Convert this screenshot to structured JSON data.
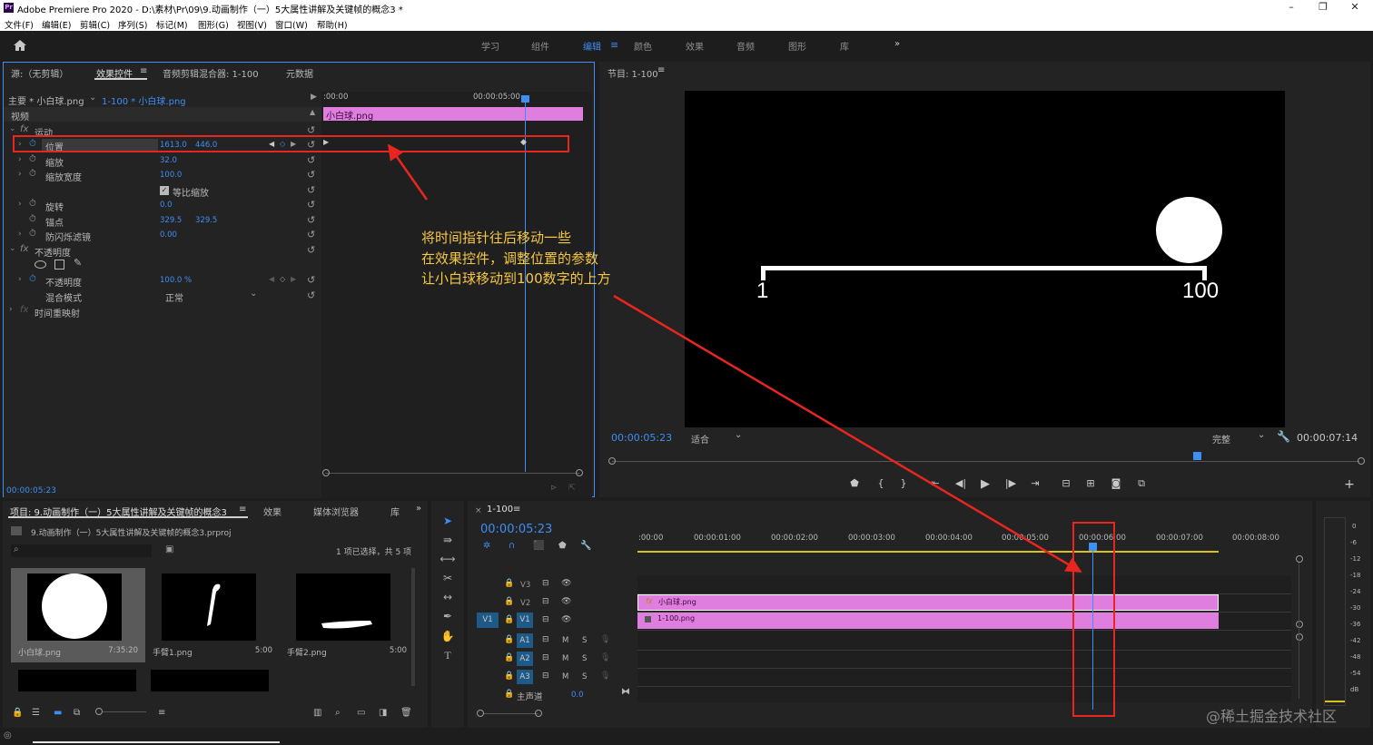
{
  "window": {
    "title": "Adobe Premiere Pro 2020 - D:\\素材\\Pr\\09\\9.动画制作（一）5大属性讲解及关键帧的概念3 *",
    "app_icon": "Pr"
  },
  "menu": [
    "文件(F)",
    "编辑(E)",
    "剪辑(C)",
    "序列(S)",
    "标记(M)",
    "图形(G)",
    "视图(V)",
    "窗口(W)",
    "帮助(H)"
  ],
  "workspaces": {
    "items": [
      "学习",
      "组件",
      "编辑",
      "颜色",
      "效果",
      "音频",
      "图形",
      "库"
    ],
    "active": "编辑",
    "more": "»"
  },
  "effect_panel": {
    "tabs": [
      "源:（无剪辑）",
      "效果控件",
      "音频剪辑混合器: 1-100",
      "元数据"
    ],
    "active_tab": "效果控件",
    "master": "主要 * 小白球.png",
    "sequence": "1-100 * 小白球.png",
    "time_start": ":00:00",
    "time_end": "00:00:05:00",
    "clip_name": "小白球.png",
    "section_video": "视频",
    "motion": "运动",
    "position": {
      "label": "位置",
      "x": "1613.0",
      "y": "446.0"
    },
    "scale": {
      "label": "缩放",
      "value": "32.0"
    },
    "scale_width": {
      "label": "缩放宽度",
      "value": "100.0"
    },
    "uniform_scale": "等比缩放",
    "rotation": {
      "label": "旋转",
      "value": "0.0"
    },
    "anchor": {
      "label": "锚点",
      "x": "329.5",
      "y": "329.5"
    },
    "antiflicker": {
      "label": "防闪烁滤镜",
      "value": "0.00"
    },
    "opacity_section": "不透明度",
    "opacity": {
      "label": "不透明度",
      "value": "100.0 %"
    },
    "blend": {
      "label": "混合模式",
      "value": "正常"
    },
    "time_remap": "时间重映射",
    "current_time": "00:00:05:23"
  },
  "annotation": {
    "lines": [
      "将时间指针往后移动一些",
      "在效果控件，调整位置的参数",
      "让小白球移动到100数字的上方"
    ],
    "color": "#f6c744",
    "box_color": "#e8261f"
  },
  "program": {
    "title": "节目: 1-100",
    "timecode": "00:00:05:23",
    "fit": "适合",
    "quality": "完整",
    "duration": "00:00:07:14",
    "scale_left": "1",
    "scale_right": "100"
  },
  "project": {
    "tabs": [
      "项目: 9.动画制作（一）5大属性讲解及关键帧的概念3",
      "效果",
      "媒体浏览器",
      "库"
    ],
    "file": "9.动画制作（一）5大属性讲解及关键帧的概念3.prproj",
    "selection": "1 项已选择，共 5 项",
    "items": [
      {
        "name": "小白球.png",
        "duration": "7:35:20"
      },
      {
        "name": "手臂1.png",
        "duration": "5:00"
      },
      {
        "name": "手臂2.png",
        "duration": "5:00"
      }
    ]
  },
  "timeline": {
    "title": "1-100",
    "timecode": "00:00:05:23",
    "ruler": [
      ":00:00",
      "00:00:01:00",
      "00:00:02:00",
      "00:00:03:00",
      "00:00:04:00",
      "00:00:05:00",
      "00:00:06:00",
      "00:00:07:00",
      "00:00:08:00"
    ],
    "video_tracks": [
      "V3",
      "V2",
      "V1"
    ],
    "audio_tracks": [
      "A1",
      "A2",
      "A3"
    ],
    "source_patch": "V1",
    "mute": "M",
    "solo": "S",
    "master": "主声道",
    "master_value": "0.0",
    "clips": [
      {
        "name": "小白球.png",
        "track": "V2"
      },
      {
        "name": "1-100.png",
        "track": "V1"
      }
    ],
    "meter_ticks": [
      "0",
      "-6",
      "-12",
      "-18",
      "-24",
      "-30",
      "-36",
      "-42",
      "-48",
      "-54",
      "dB"
    ]
  },
  "watermark": "@稀土掘金技术社区"
}
